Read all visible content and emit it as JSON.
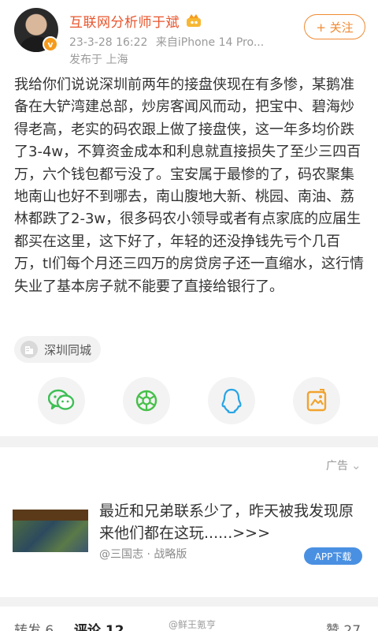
{
  "author": {
    "name": "互联网分析师于斌",
    "badge": "v",
    "timestamp": "23-3-28 16:22",
    "source": "来自iPhone 14 Pro...",
    "location": "发布于 上海"
  },
  "follow_label": "+ 关注",
  "post_text": "我给你们说说深圳前两年的接盘侠现在有多惨，某鹅准备在大铲湾建总部，炒房客闻风而动，把宝中、碧海炒得老高，老实的码农跟上做了接盘侠，这一年多均价跌了3-4w，不算资金成本和利息就直接损失了至少三四百万，六个钱包都亏没了。宝安属于最惨的了，码农聚集地南山也好不到哪去，南山腹地大新、桃园、南油、荔林都跌了2-3w，很多码农小领导或者有点家底的应届生都买在这里，这下好了，年轻的还没挣钱先亏个几百万，tl们每个月还三四万的房贷房子还一直缩水，这行情失业了基本房子就不能要了直接给银行了。",
  "topic": "深圳同城",
  "share_icons": [
    "wechat-icon",
    "moments-icon",
    "qq-icon",
    "gallery-icon"
  ],
  "ad": {
    "label": "广告",
    "close": "⌄",
    "headline": "最近和兄弟联系少了，昨天被我发现原来他们都在这玩......>>>",
    "source": "@三国志 · 战略版",
    "cta": "APP下载"
  },
  "bottom_bar": {
    "repost": "转发 6",
    "comments": "评论 12",
    "likes": "赞 27",
    "watermark": "@鲜王氪亨"
  },
  "colors": {
    "name": "#e8552d",
    "follow": "#f08a32",
    "wechat": "#3dbf55",
    "moments": "#47c04a",
    "qq": "#27a4e6",
    "gallery": "#f2a32d",
    "cta": "#4a90e2"
  }
}
